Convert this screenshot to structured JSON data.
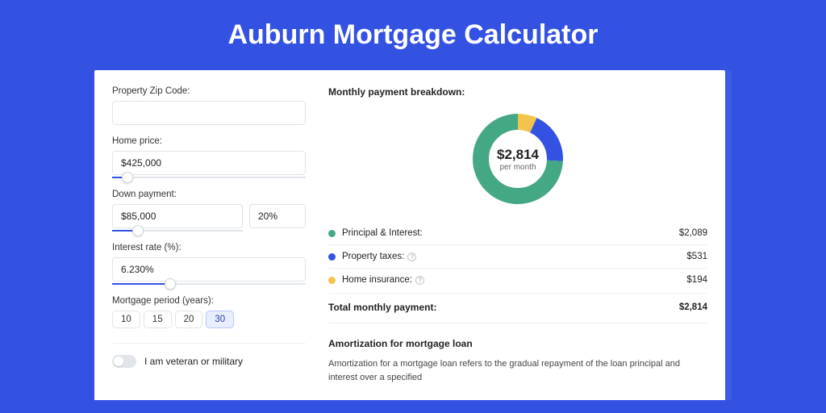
{
  "hero": {
    "title": "Auburn Mortgage Calculator"
  },
  "form": {
    "zip": {
      "label": "Property Zip Code:",
      "value": ""
    },
    "home_price": {
      "label": "Home price:",
      "value": "$425,000",
      "slider_pct": 8
    },
    "down_payment": {
      "label": "Down payment:",
      "amount": "$85,000",
      "percent": "20%",
      "slider_pct": 20
    },
    "interest": {
      "label": "Interest rate (%):",
      "value": "6.230%",
      "slider_pct": 30
    },
    "period": {
      "label": "Mortgage period (years):",
      "options": [
        "10",
        "15",
        "20",
        "30"
      ],
      "selected": "30"
    },
    "veteran": {
      "label": "I am veteran or military",
      "on": false
    }
  },
  "breakdown": {
    "title": "Monthly payment breakdown:",
    "center_value": "$2,814",
    "center_sub": "per month",
    "items": [
      {
        "label": "Principal & Interest:",
        "value": "$2,089",
        "raw": 2089,
        "color": "green"
      },
      {
        "label": "Property taxes:",
        "value": "$531",
        "raw": 531,
        "color": "blue",
        "info": true
      },
      {
        "label": "Home insurance:",
        "value": "$194",
        "raw": 194,
        "color": "yellow",
        "info": true
      }
    ],
    "total": {
      "label": "Total monthly payment:",
      "value": "$2,814"
    }
  },
  "amort": {
    "title": "Amortization for mortgage loan",
    "body": "Amortization for a mortgage loan refers to the gradual repayment of the loan principal and interest over a specified"
  },
  "chart_data": {
    "type": "pie",
    "title": "Monthly payment breakdown",
    "series": [
      {
        "name": "Principal & Interest",
        "value": 2089
      },
      {
        "name": "Property taxes",
        "value": 531
      },
      {
        "name": "Home insurance",
        "value": 194
      }
    ],
    "center_label": "$2,814 per month",
    "colors": {
      "Principal & Interest": "#45a884",
      "Property taxes": "#3452e1",
      "Home insurance": "#f3c44b"
    }
  }
}
